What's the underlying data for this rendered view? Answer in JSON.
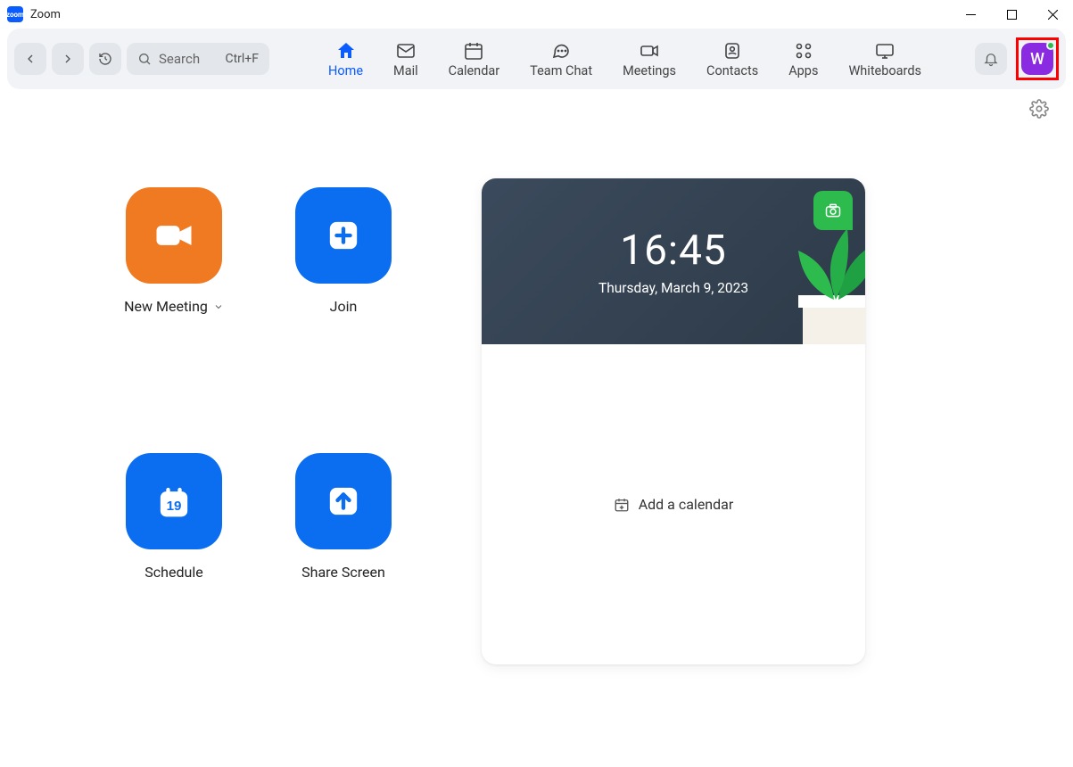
{
  "window": {
    "title": "Zoom"
  },
  "topbar": {
    "search_placeholder": "Search",
    "search_shortcut": "Ctrl+F",
    "tabs": {
      "home": "Home",
      "mail": "Mail",
      "calendar": "Calendar",
      "team_chat": "Team Chat",
      "meetings": "Meetings",
      "contacts": "Contacts",
      "apps": "Apps",
      "whiteboards": "Whiteboards"
    },
    "avatar_initial": "W"
  },
  "actions": {
    "new_meeting": "New Meeting",
    "join": "Join",
    "schedule": "Schedule",
    "schedule_day": "19",
    "share_screen": "Share Screen"
  },
  "card": {
    "time": "16:45",
    "date": "Thursday, March 9, 2023",
    "add_calendar": "Add a calendar"
  }
}
